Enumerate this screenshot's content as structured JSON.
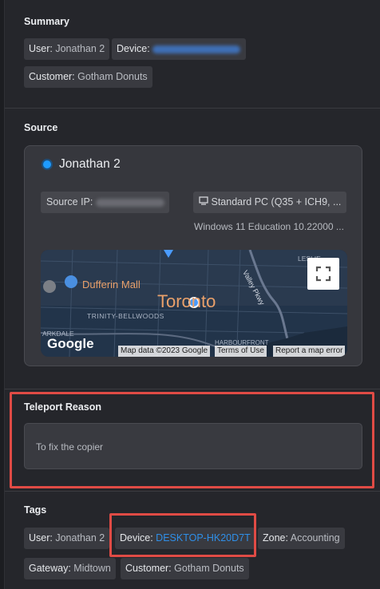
{
  "summary": {
    "title": "Summary",
    "chips": [
      {
        "key": "User:",
        "value": "Jonathan 2"
      },
      {
        "key": "Device:",
        "value": ""
      },
      {
        "key": "Customer:",
        "value": "Gotham Donuts"
      }
    ]
  },
  "source": {
    "title": "Source",
    "user": "Jonathan 2",
    "source_ip_label": "Source IP:",
    "machine": "Standard PC (Q35 + ICH9, ...",
    "os": "Windows 11 Education 10.22000 ...",
    "map": {
      "city": "Toronto",
      "labels": [
        "Dufferin Mall",
        "TRINITY-BELLWOODS",
        "ARKDALE",
        "HARBOURFRONT",
        "Valley Pkwy",
        "LESLIE"
      ],
      "logo": "Google",
      "attribution": [
        "Map data ©2023 Google",
        "Terms of Use",
        "Report a map error"
      ]
    }
  },
  "teleport": {
    "title": "Teleport Reason",
    "reason": "To fix the copier"
  },
  "tags": {
    "title": "Tags",
    "chips": [
      {
        "key": "User:",
        "value": "Jonathan 2"
      },
      {
        "key": "Device:",
        "value": "DESKTOP-HK20D7T"
      },
      {
        "key": "Zone:",
        "value": "Accounting"
      },
      {
        "key": "Gateway:",
        "value": "Midtown"
      },
      {
        "key": "Customer:",
        "value": "Gotham Donuts"
      }
    ]
  },
  "colors": {
    "accent": "#1e9bff",
    "highlight": "#e04b45",
    "link": "#2f8fe8"
  }
}
